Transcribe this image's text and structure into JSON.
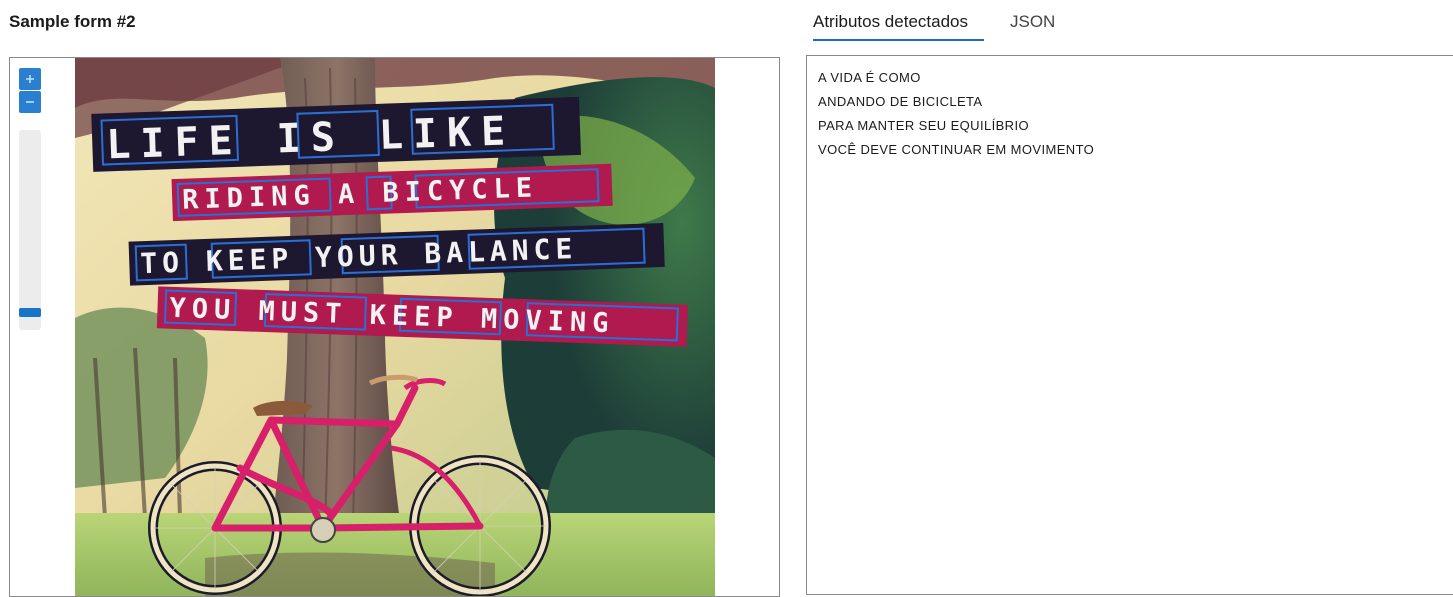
{
  "form": {
    "title": "Sample form #2"
  },
  "viewer": {
    "zoom_level_fraction": 0.94,
    "image": {
      "banners": [
        {
          "text": "LIFE IS LIKE",
          "color": "#1e1730"
        },
        {
          "text": "RIDING A BICYCLE",
          "color": "#b01a4e"
        },
        {
          "text": "TO KEEP YOUR BALANCE",
          "color": "#1e1730"
        },
        {
          "text": "YOU MUST KEEP MOVING",
          "color": "#b01a4e"
        }
      ],
      "highlight_color": "#2a6fd6"
    }
  },
  "tabs": {
    "active_label": "Atributos detectados",
    "json_label": "JSON"
  },
  "results": {
    "lines": [
      "A VIDA  É  COMO",
      "ANDANDO  DE  BICICLETA",
      "PARA  MANTER  SEU  EQUILÍBRIO",
      "VOCÊ  DEVE  CONTINUAR  EM  MOVIMENTO"
    ]
  },
  "colors": {
    "accent": "#1d6cc1",
    "zoom_button": "#2a7fd0",
    "zoom_thumb": "#1774c9"
  },
  "icons": {
    "zoom_in": "plus-icon",
    "zoom_out": "minus-icon"
  }
}
